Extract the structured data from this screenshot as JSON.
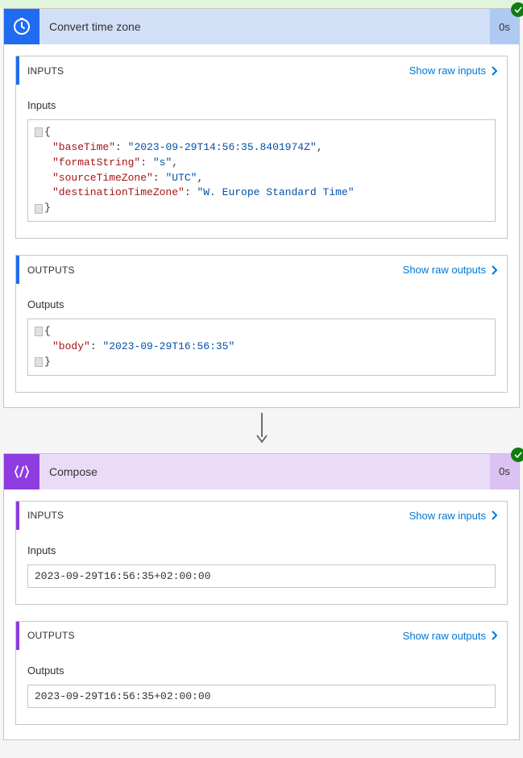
{
  "actions": [
    {
      "id": "convert",
      "title": "Convert time zone",
      "duration": "0s",
      "inputs": {
        "panel_title": "INPUTS",
        "raw_link": "Show raw inputs",
        "sub_label": "Inputs",
        "json": {
          "baseTime": "2023-09-29T14:56:35.8401974Z",
          "formatString": "s",
          "sourceTimeZone": "UTC",
          "destinationTimeZone": "W. Europe Standard Time"
        }
      },
      "outputs": {
        "panel_title": "OUTPUTS",
        "raw_link": "Show raw outputs",
        "sub_label": "Outputs",
        "json": {
          "body": "2023-09-29T16:56:35"
        }
      }
    },
    {
      "id": "compose",
      "title": "Compose",
      "duration": "0s",
      "inputs": {
        "panel_title": "INPUTS",
        "raw_link": "Show raw inputs",
        "sub_label": "Inputs",
        "text": "2023-09-29T16:56:35+02:00:00"
      },
      "outputs": {
        "panel_title": "OUTPUTS",
        "raw_link": "Show raw outputs",
        "sub_label": "Outputs",
        "text": "2023-09-29T16:56:35+02:00:00"
      }
    }
  ]
}
